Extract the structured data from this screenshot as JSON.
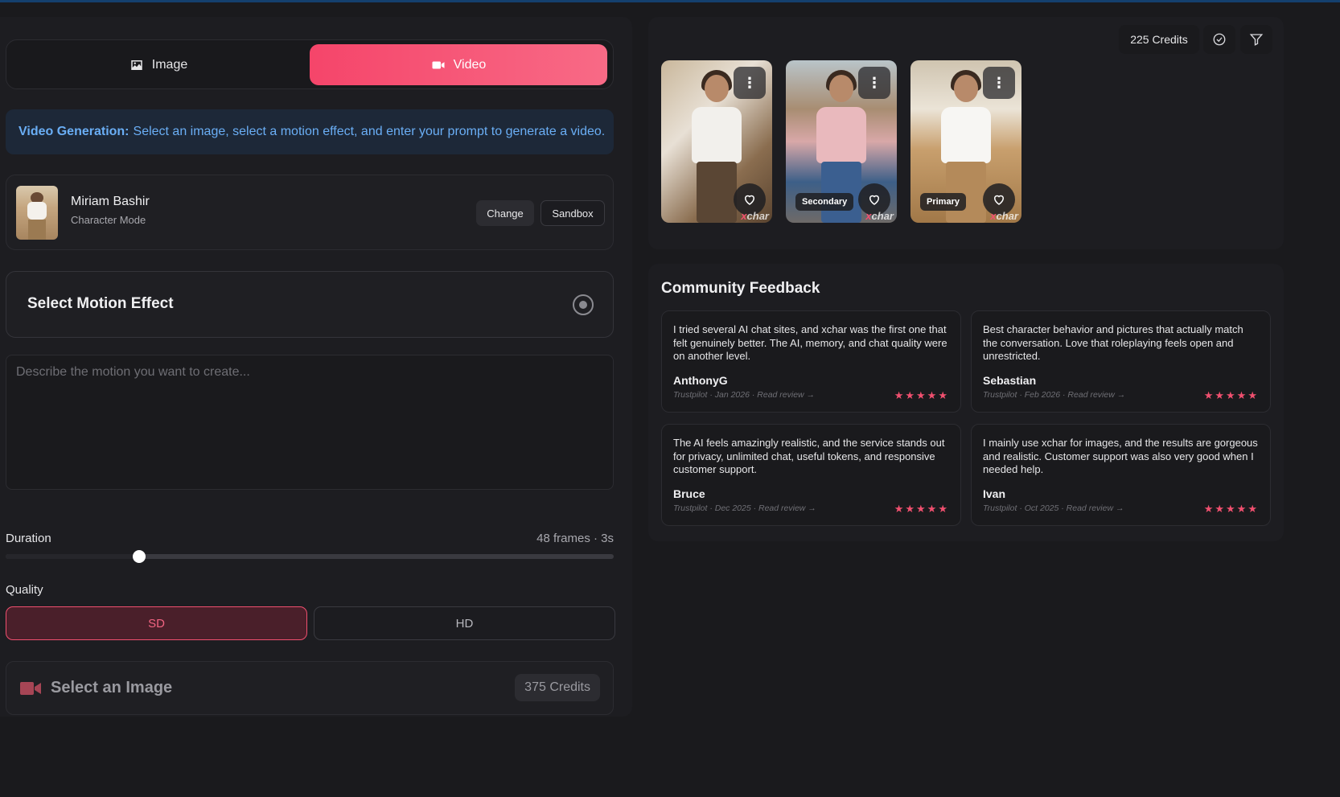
{
  "tabs": {
    "image_label": "Image",
    "video_label": "Video"
  },
  "info_banner": {
    "bold": "Video Generation:",
    "text": "Select an image, select a motion effect, and enter your prompt to generate a video."
  },
  "character": {
    "name": "Miriam Bashir",
    "mode": "Character Mode",
    "change_label": "Change",
    "sandbox_label": "Sandbox"
  },
  "motion": {
    "title": "Select Motion Effect"
  },
  "prompt": {
    "placeholder": "Describe the motion you want to create...",
    "value": ""
  },
  "duration": {
    "label": "Duration",
    "value_text": "48 frames · 3s",
    "slider_fraction": 0.22
  },
  "quality": {
    "label": "Quality",
    "options": [
      "SD",
      "HD"
    ],
    "selected": "SD"
  },
  "generate": {
    "label": "Select an Image",
    "credits": "375 Credits"
  },
  "gallery": {
    "credits": "225 Credits",
    "photos": [
      {
        "badge": "",
        "watermark_x": "x",
        "watermark_rest": "char"
      },
      {
        "badge": "Secondary",
        "watermark_x": "x",
        "watermark_rest": "char"
      },
      {
        "badge": "Primary",
        "watermark_x": "x",
        "watermark_rest": "char"
      }
    ]
  },
  "feedback": {
    "title": "Community Feedback",
    "reviews": [
      {
        "text": "I tried several AI chat sites, and xchar was the first one that felt genuinely better. The AI, memory, and chat quality were on another level.",
        "author": "AnthonyG",
        "meta": "Trustpilot · Jan 2026 · Read review →",
        "stars": "★★★★★"
      },
      {
        "text": "Best character behavior and pictures that actually match the conversation. Love that roleplaying feels open and unrestricted.",
        "author": "Sebastian",
        "meta": "Trustpilot · Feb 2026 · Read review →",
        "stars": "★★★★★"
      },
      {
        "text": "The AI feels amazingly realistic, and the service stands out for privacy, unlimited chat, useful tokens, and responsive customer support.",
        "author": "Bruce",
        "meta": "Trustpilot · Dec 2025 · Read review →",
        "stars": "★★★★★"
      },
      {
        "text": "I mainly use xchar for images, and the results are gorgeous and realistic. Customer support was also very good when I needed help.",
        "author": "Ivan",
        "meta": "Trustpilot · Oct 2025 · Read review →",
        "stars": "★★★★★"
      }
    ]
  },
  "colors": {
    "accent": "#f5456a",
    "info_text": "#6aaef5",
    "background": "#1a1a1d"
  }
}
